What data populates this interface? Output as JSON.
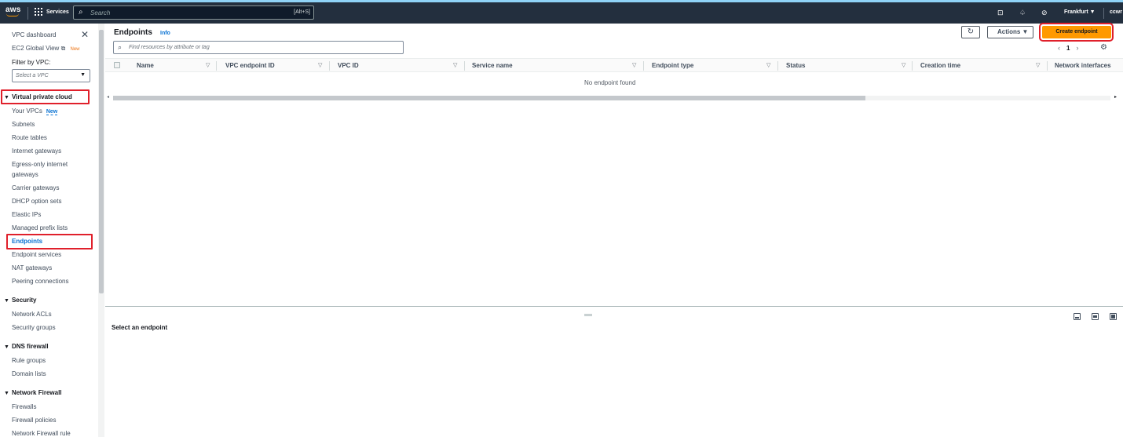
{
  "topbar": {
    "logo_text": "aws",
    "services_label": "Services",
    "search_placeholder": "Search",
    "search_shortcut": "[Alt+S]",
    "region": "Frankfurt ▼",
    "user": "ccwr"
  },
  "sidebar": {
    "vpc_dashboard": "VPC dashboard",
    "ec2_global_view": "EC2 Global View",
    "ec2_badge": "New",
    "filter_label": "Filter by VPC:",
    "vpc_select_placeholder": "Select a VPC",
    "sections": [
      {
        "title": "Virtual private cloud",
        "items": [
          {
            "label": "Your VPCs",
            "badge": "New"
          },
          {
            "label": "Subnets"
          },
          {
            "label": "Route tables"
          },
          {
            "label": "Internet gateways"
          },
          {
            "label": "Egress-only internet gateways"
          },
          {
            "label": "Carrier gateways"
          },
          {
            "label": "DHCP option sets"
          },
          {
            "label": "Elastic IPs"
          },
          {
            "label": "Managed prefix lists"
          },
          {
            "label": "Endpoints"
          },
          {
            "label": "Endpoint services"
          },
          {
            "label": "NAT gateways"
          },
          {
            "label": "Peering connections"
          }
        ]
      },
      {
        "title": "Security",
        "items": [
          {
            "label": "Network ACLs"
          },
          {
            "label": "Security groups"
          }
        ]
      },
      {
        "title": "DNS firewall",
        "items": [
          {
            "label": "Rule groups"
          },
          {
            "label": "Domain lists"
          }
        ]
      },
      {
        "title": "Network Firewall",
        "items": [
          {
            "label": "Firewalls"
          },
          {
            "label": "Firewall policies"
          },
          {
            "label": "Network Firewall rule"
          }
        ]
      }
    ]
  },
  "main": {
    "title": "Endpoints",
    "info": "Info",
    "find_placeholder": "Find resources by attribute or tag",
    "actions_label": "Actions ▼",
    "create_label": "Create endpoint",
    "page_number": "1",
    "columns": [
      "Name",
      "VPC endpoint ID",
      "VPC ID",
      "Service name",
      "Endpoint type",
      "Status",
      "Creation time",
      "Network interfaces"
    ],
    "empty_message": "No endpoint found"
  },
  "details": {
    "title": "Select an endpoint"
  },
  "colors": {
    "topbar_bg": "#232f3e",
    "primary_button": "#ff9900",
    "highlight_box": "#e0202b",
    "link": "#0972d3"
  }
}
